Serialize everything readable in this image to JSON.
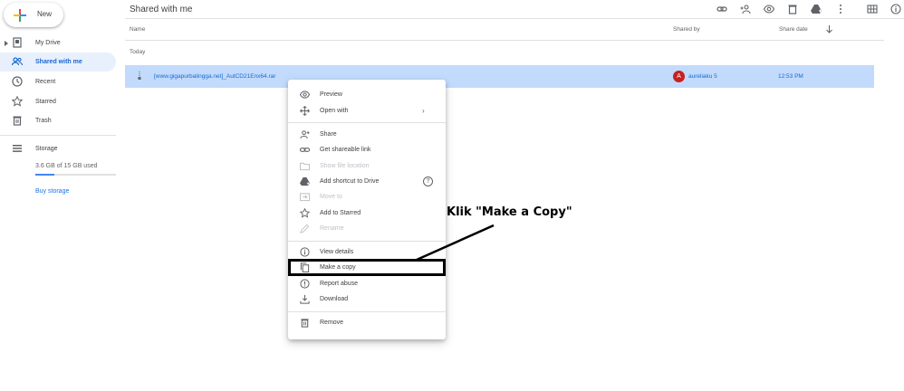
{
  "header": {
    "title": "Shared with me"
  },
  "new_button": {
    "label": "New"
  },
  "sidebar": {
    "items": [
      {
        "label": "My Drive",
        "icon": "drive-icon"
      },
      {
        "label": "Shared with me",
        "icon": "people-icon"
      },
      {
        "label": "Recent",
        "icon": "clock-icon"
      },
      {
        "label": "Starred",
        "icon": "star-icon"
      },
      {
        "label": "Trash",
        "icon": "trash-icon"
      }
    ],
    "storage": {
      "label": "Storage",
      "used": "3.6 GB of 15 GB used",
      "fraction": 0.24,
      "buy": "Buy storage"
    }
  },
  "table": {
    "columns": {
      "name": "Name",
      "shared_by": "Shared by",
      "share_date": "Share date"
    },
    "group": "Today",
    "row": {
      "name": "[www.gigapurbalingga.net]_AutCD21Enx64.rar",
      "avatar": "A",
      "shared_by": "aureliaku 5",
      "date": "12:53 PM"
    }
  },
  "menu": {
    "items": [
      {
        "label": "Preview",
        "icon": "eye-icon"
      },
      {
        "label": "Open with",
        "icon": "move-icon"
      },
      {
        "label": "Share",
        "icon": "add-person-icon"
      },
      {
        "label": "Get shareable link",
        "icon": "link-icon"
      },
      {
        "label": "Show file location",
        "icon": "folder-icon"
      },
      {
        "label": "Add shortcut to Drive",
        "icon": "drive-shortcut-icon"
      },
      {
        "label": "Move to",
        "icon": "move-to-icon"
      },
      {
        "label": "Add to Starred",
        "icon": "star-icon"
      },
      {
        "label": "Rename",
        "icon": "pencil-icon"
      },
      {
        "label": "View details",
        "icon": "info-icon"
      },
      {
        "label": "Make a copy",
        "icon": "copy-icon"
      },
      {
        "label": "Report abuse",
        "icon": "alert-icon"
      },
      {
        "label": "Download",
        "icon": "download-icon"
      },
      {
        "label": "Remove",
        "icon": "trash-icon"
      }
    ],
    "help_glyph": "?",
    "submenu_arrow": "›"
  },
  "annotation": {
    "text": "Klik \"Make a Copy\""
  },
  "colors": {
    "accent": "#1a73e8",
    "selected_row": "#c2dbfc",
    "avatar": "#c5221f"
  }
}
